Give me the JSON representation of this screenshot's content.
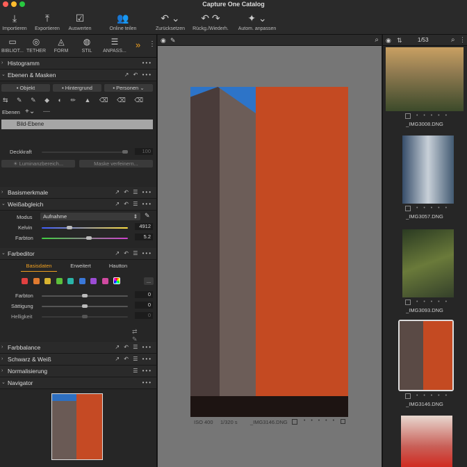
{
  "window": {
    "title": "Capture One Catalog",
    "colors": {
      "close": "#ff5f57",
      "min": "#febc2e",
      "max": "#28c840"
    }
  },
  "toolbar": {
    "items": [
      {
        "label": "Importieren",
        "icon": "import-icon"
      },
      {
        "label": "Exportieren",
        "icon": "export-icon"
      },
      {
        "label": "Auswerten",
        "icon": "clipboard-icon"
      },
      {
        "label": "Online teilen",
        "icon": "people-icon"
      },
      {
        "label": "Zurücksetzen",
        "icon": "reset-icon"
      },
      {
        "label": "Rückg./Wiederh.",
        "icon": "undo-redo-icon"
      },
      {
        "label": "Autom. anpassen",
        "icon": "magic-wand-icon"
      }
    ]
  },
  "tooltabs": {
    "items": [
      "BIBLIOT...",
      "TETHER",
      "FORM",
      "STIL",
      "ANPASS..."
    ],
    "more": "»"
  },
  "sections": {
    "histogram": "Histogramm",
    "layers": "Ebenen & Masken",
    "basic": "Basismerkmale",
    "wb": "Weißabgleich",
    "coloreditor": "Farbeditor",
    "colorbalance": "Farbbalance",
    "bw": "Schwarz & Weiß",
    "normalize": "Normalisierung",
    "navigator": "Navigator"
  },
  "layers": {
    "buttons": [
      "Objekt",
      "Hintergrund",
      "Personen"
    ],
    "ebenen_label": "Ebenen",
    "add": "+",
    "layer_name": "Bild-Ebene",
    "opacity_label": "Deckkraft",
    "opacity_value": "100",
    "luminance_btn": "Luminanzbereich...",
    "refine_btn": "Maske verfeinern..."
  },
  "wb": {
    "mode_label": "Modus",
    "mode_value": "Aufnahme",
    "kelvin_label": "Kelvin",
    "kelvin_value": "4912",
    "tint_label": "Farbton",
    "tint_value": "5.2"
  },
  "coloreditor": {
    "tabs": [
      "Basisdaten",
      "Erweitert",
      "Hautton"
    ],
    "swatches": [
      "#e04040",
      "#e07a30",
      "#d9b430",
      "#5cbf3c",
      "#2ab4a8",
      "#3a78d8",
      "#9b4cd4",
      "#d04aa0"
    ],
    "more": "...",
    "hue_label": "Farbton",
    "hue_value": "0",
    "sat_label": "Sättigung",
    "sat_value": "0",
    "light_label": "Helligkeit",
    "light_value": "0"
  },
  "viewer": {
    "iso": "ISO 400",
    "shutter": "1/320 s",
    "filename": "_IMG3146.DNG"
  },
  "browser": {
    "count": "1/53",
    "thumbs": [
      {
        "name": "_IMG3008.DNG"
      },
      {
        "name": "_IMG3057.DNG"
      },
      {
        "name": "_IMG3093.DNG"
      },
      {
        "name": "_IMG3146.DNG"
      }
    ],
    "dots": "• • • • •"
  }
}
